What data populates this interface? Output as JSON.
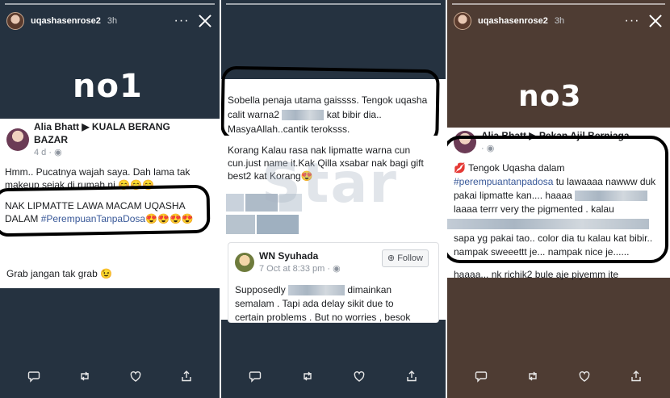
{
  "stories": [
    {
      "username": "uqashasenrose2",
      "time": "3h",
      "label": "no1",
      "card": {
        "poster": "Alia Bhatt ▶ KUALA BERANG BAZAR",
        "meta": "4 d · ◉",
        "para1": "Hmm.. Pucatnya wajah saya. Dah lama tak makeup sejak di rumah ni 😊😊😊",
        "para2_text": "NAK LIPMATTE LAWA MACAM UQASHA DALAM ",
        "para2_hashtag": "#PerempuanTanpaDosa",
        "para2_emoji": "😍😍😍😍",
        "para3": "Grab jangan tak grab 😉"
      }
    },
    {
      "card_top": {
        "line1": "Sobella penaja utama gaissss. Tengok uqasha",
        "line2a": "calit warna2",
        "line2b": "kat bibir dia..",
        "line3": "MasyaAllah..cantik teroksss."
      },
      "card_mid": "Korang Kalau rasa nak lipmatte warna cun cun.just name it.Kak Qilla xsabar nak bagi gift best2 kat Korang😍",
      "shared": {
        "name": "WN Syuhada",
        "meta": "7 Oct at 8:33 pm · ◉",
        "follow": "Follow",
        "text1a": "Supposedly",
        "text1b": "dimainkan",
        "text2": "semalam . Tapi ada delay sikit due to",
        "text3": "certain problems . But no worries , besok"
      },
      "watermark": "Star"
    },
    {
      "username": "uqashasenrose2",
      "time": "3h",
      "label": "no3",
      "card": {
        "poster": "Alia Bhatt ▶ Pekan Ajil Berniaga",
        "meta": "· ◉",
        "line1": "💋 Tengok Uqasha dalam",
        "line2_hashtag": "#perempuantanpadosa",
        "line2_text": " tu lawaaaa nawww duk",
        "line3": "pakai lipmatte kan.... haaaa",
        "line4": "laaaa terrr       very the pigmented . kalau",
        "line6": "sapa yg pakai tao.. color dia tu kalau kat bibir..",
        "line7": "nampak sweeettt je... nampak nice je......",
        "line8": "haaaa... nk richik2 bule aje piyemm ite"
      }
    }
  ],
  "nav_icons": [
    "reply-icon",
    "retweet-icon",
    "heart-icon",
    "share-icon"
  ],
  "colors": {
    "panel_blue": "#253240",
    "panel_brown": "#4e3c33",
    "hashtag": "#385898"
  }
}
